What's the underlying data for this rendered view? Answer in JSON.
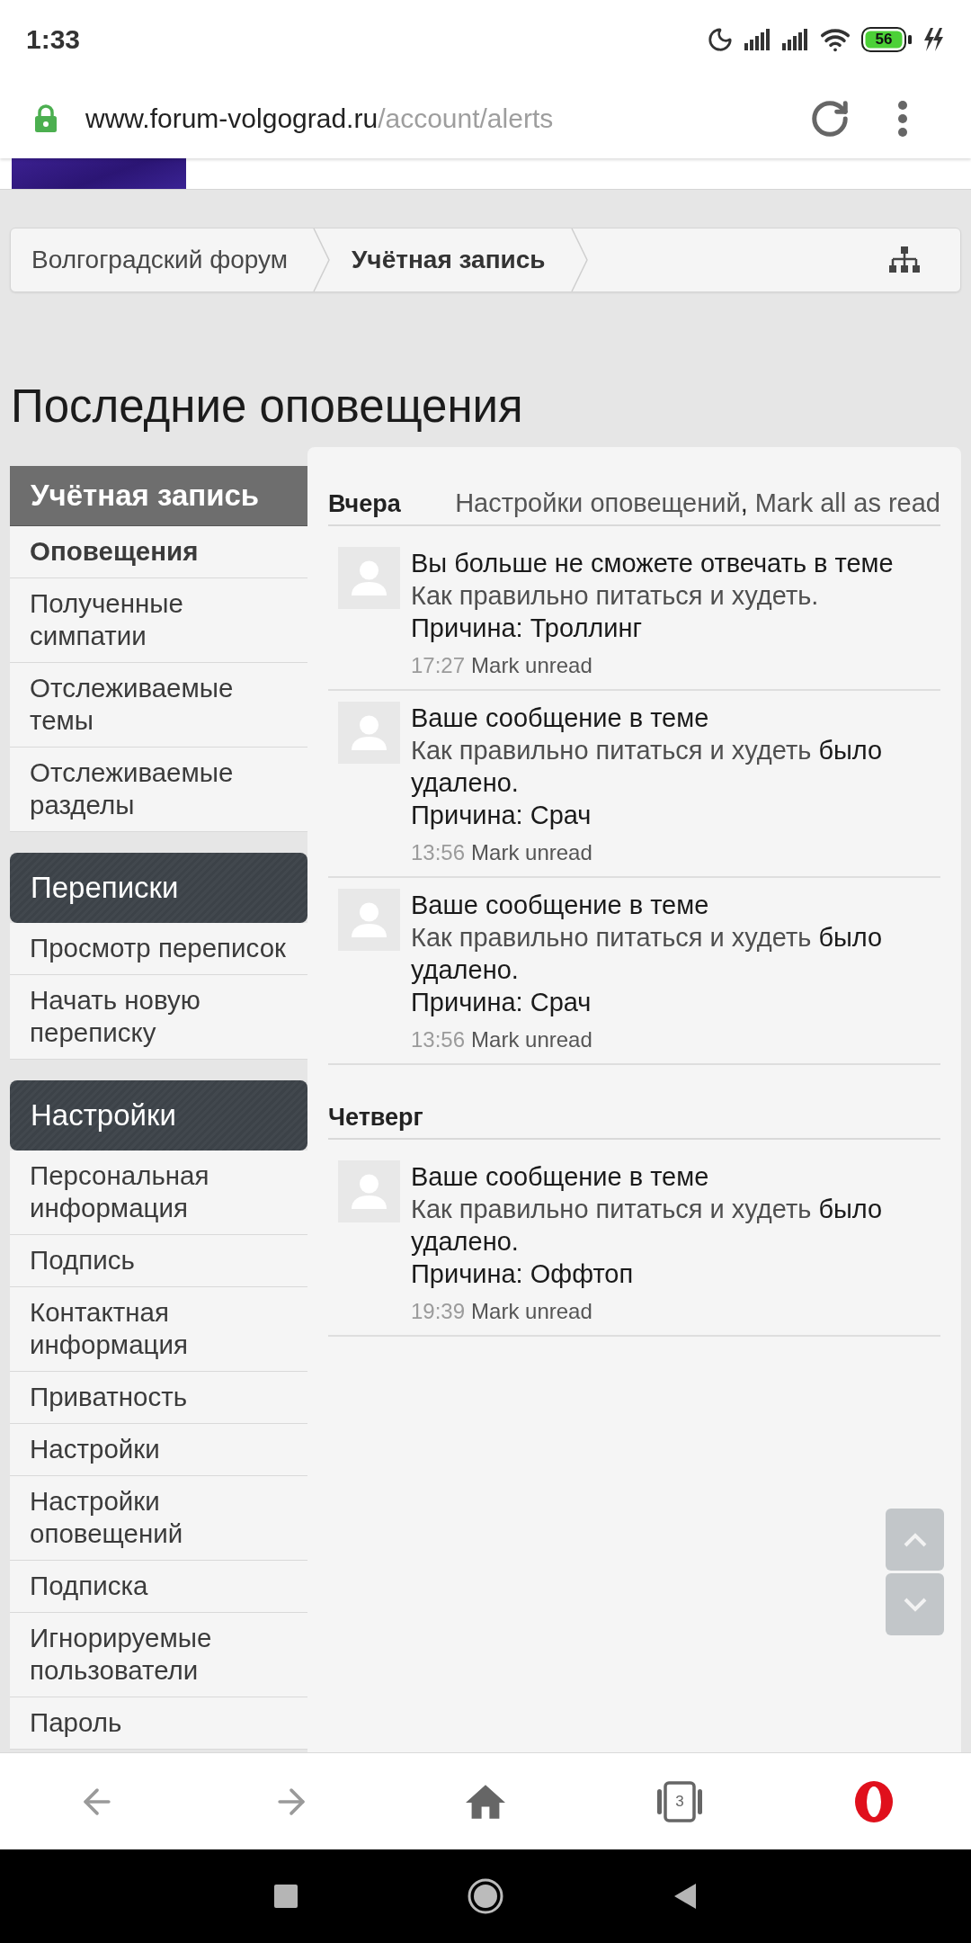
{
  "status_bar": {
    "time": "1:33",
    "battery": "56"
  },
  "address_bar": {
    "host": "www.forum-volgograd.ru",
    "path": "/account/alerts"
  },
  "breadcrumbs": [
    {
      "label": "Волгоградский форум",
      "selected": false
    },
    {
      "label": "Учётная запись",
      "selected": true
    }
  ],
  "page_title": "Последние оповещения",
  "sidebar": {
    "sections": [
      {
        "kind": "primary",
        "title": "Учётная запись",
        "items": [
          {
            "label": "Оповещения",
            "selected": true
          },
          {
            "label": "Полученные симпатии",
            "selected": false
          },
          {
            "label": "Отслеживаемые темы",
            "selected": false
          },
          {
            "label": "Отслеживаемые разделы",
            "selected": false
          }
        ]
      },
      {
        "kind": "secondary",
        "title": "Переписки",
        "items": [
          {
            "label": "Просмотр переписок",
            "selected": false
          },
          {
            "label": "Начать новую переписку",
            "selected": false
          }
        ]
      },
      {
        "kind": "secondary",
        "title": "Настройки",
        "items": [
          {
            "label": "Персональная информация",
            "selected": false
          },
          {
            "label": "Подпись",
            "selected": false
          },
          {
            "label": "Контактная информация",
            "selected": false
          },
          {
            "label": "Приватность",
            "selected": false
          },
          {
            "label": "Настройки",
            "selected": false
          },
          {
            "label": "Настройки оповещений",
            "selected": false
          },
          {
            "label": "Подписка",
            "selected": false
          },
          {
            "label": "Игнорируемые пользователи",
            "selected": false
          },
          {
            "label": "Пароль",
            "selected": false
          }
        ]
      }
    ]
  },
  "alerts": {
    "sections": [
      {
        "title": "Вчера",
        "links": [
          "Настройки оповещений",
          "Mark all as read"
        ],
        "separator": ",",
        "items": [
          {
            "segments": [
              {
                "kind": "plain",
                "text": "Вы больше не сможете отвечать в теме"
              },
              {
                "kind": "link",
                "text": "Как правильно питаться и худеть."
              }
            ],
            "reason": "Причина: Троллинг",
            "time": "17:27",
            "action": "Mark unread"
          },
          {
            "segments": [
              {
                "kind": "plain",
                "text": "Ваше сообщение в теме"
              },
              {
                "kind": "link",
                "text": "Как правильно питаться и худеть"
              },
              {
                "kind": "plain",
                "text": "было удалено."
              }
            ],
            "reason": "Причина: Срач",
            "time": "13:56",
            "action": "Mark unread"
          },
          {
            "segments": [
              {
                "kind": "plain",
                "text": "Ваше сообщение в теме"
              },
              {
                "kind": "link",
                "text": "Как правильно питаться и худеть"
              },
              {
                "kind": "plain",
                "text": "было удалено."
              }
            ],
            "reason": "Причина: Срач",
            "time": "13:56",
            "action": "Mark unread"
          }
        ]
      },
      {
        "title": "Четверг",
        "items": [
          {
            "segments": [
              {
                "kind": "plain",
                "text": "Ваше сообщение в теме"
              },
              {
                "kind": "link",
                "text": "Как правильно питаться и худеть"
              },
              {
                "kind": "plain",
                "text": "было удалено."
              }
            ],
            "reason": "Причина: Оффтоп",
            "time": "19:39",
            "action": "Mark unread"
          }
        ]
      }
    ]
  },
  "bottom_bar": {
    "tab_count": "3"
  }
}
